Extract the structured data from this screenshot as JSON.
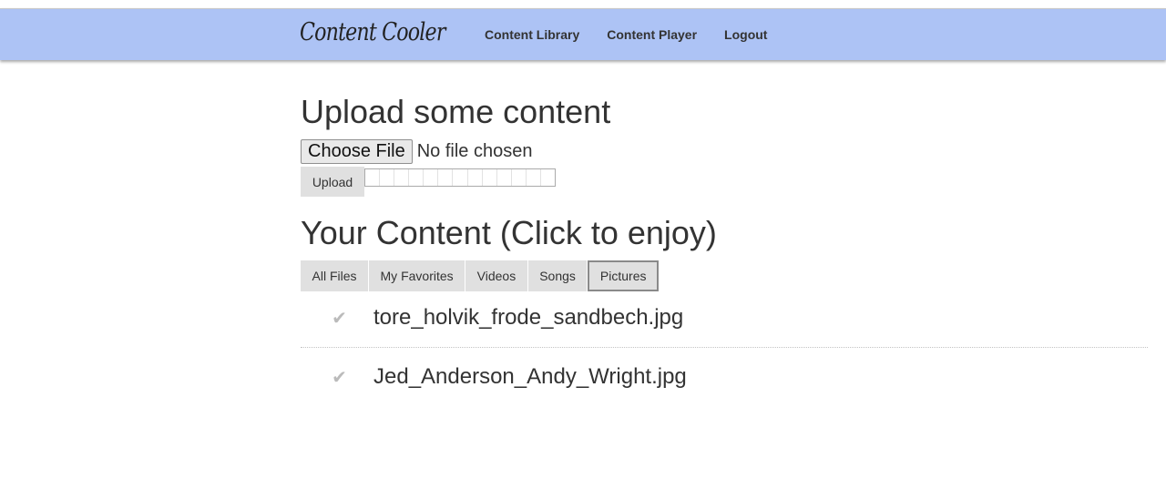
{
  "navbar": {
    "brand": "Content Cooler",
    "links": [
      "Content Library",
      "Content Player",
      "Logout"
    ]
  },
  "upload": {
    "title": "Upload some content",
    "choose_label": "Choose File",
    "file_status": "No file chosen",
    "upload_label": "Upload"
  },
  "content": {
    "title": "Your Content (Click to enjoy)",
    "tabs": [
      "All Files",
      "My Favorites",
      "Videos",
      "Songs",
      "Pictures"
    ],
    "active_tab": "Pictures",
    "files": [
      {
        "check": "✔",
        "name": "tore_holvik_frode_sandbech.jpg"
      },
      {
        "check": "✔",
        "name": "Jed_Anderson_Andy_Wright.jpg"
      }
    ]
  },
  "colors": {
    "navbar_bg": "#adc3f5",
    "tab_bg": "#e0e0e0",
    "check_color": "#bbbbbb"
  }
}
